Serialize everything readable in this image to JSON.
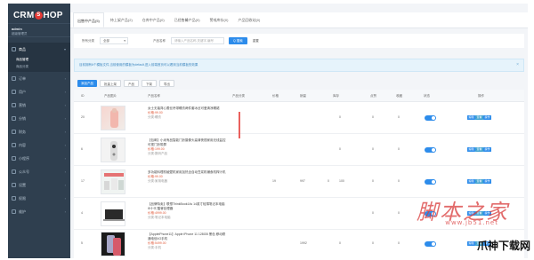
{
  "app": {
    "logo_prefix": "CRM",
    "logo_o": "S",
    "logo_suffix": "HOP"
  },
  "user": {
    "name": "admin",
    "role": "超级管理员"
  },
  "sidebar": {
    "items": [
      {
        "label": "商品",
        "active": true
      },
      {
        "label": "订单"
      },
      {
        "label": "用户"
      },
      {
        "label": "营销"
      },
      {
        "label": "分销"
      },
      {
        "label": "财务"
      },
      {
        "label": "内容"
      },
      {
        "label": "小程序"
      },
      {
        "label": "公众号"
      },
      {
        "label": "设置"
      },
      {
        "label": "权限"
      },
      {
        "label": "维护"
      }
    ],
    "submenu": [
      {
        "label": "商品管理",
        "active": true
      },
      {
        "label": "商品分类"
      }
    ]
  },
  "tabs": [
    {
      "label": "出售中产品(5)",
      "active": true
    },
    {
      "label": "待上架产品(2)"
    },
    {
      "label": "仓库中产品(0)"
    },
    {
      "label": "已经售馨产品(0)"
    },
    {
      "label": "警戒库存(0)"
    },
    {
      "label": "产品回收站(0)"
    }
  ],
  "filter": {
    "category_label": "所有分类",
    "category_value": "全部",
    "search_label": "产品名称",
    "search_placeholder": "请输入产品名称,关键字,编号",
    "search_button": "Q 搜索",
    "reset_button": "重置"
  },
  "notice": {
    "text": "目前拥有6个模板文件,当前使用的模板为default,进入前端首页可以看到当前模板的效果",
    "close": "×"
  },
  "actions": {
    "add_button": "添加产品",
    "batch_buttons": [
      "批量上架",
      "产品",
      "下架",
      "导出"
    ]
  },
  "table": {
    "columns": [
      "ID",
      "产品图片",
      "产品名称",
      "产品分类",
      "价格",
      "销量",
      "库存",
      "点赞",
      "收藏",
      "状态",
      "操作"
    ],
    "rows": [
      {
        "id": "20",
        "name": "女士无袖背心蕾丝吊带睡衣两件套冰丝可爱清凉睡裙",
        "tag": "价格:99.00",
        "meta": "分类:睡衣",
        "category": "",
        "price": "",
        "sales": "",
        "stock": "0",
        "likes": "0",
        "collect": "0",
        "ops": [
          "编辑",
          "查看",
          "操作"
        ]
      },
      {
        "id": "6",
        "name": "【包邮】小米有品智能门铃摄像头高清夜视家用无线监控可视门铃带屏",
        "tag": "价格:199.00",
        "meta": "分类:数码产品",
        "category": "",
        "price": "",
        "sales": "",
        "stock": "0",
        "likes": "0",
        "collect": "0",
        "ops": [
          "编辑",
          "查看",
          "操作"
        ]
      },
      {
        "id": "17",
        "name": "多功能料理机破壁机家用加热全自动豆浆机辅食机榨汁机",
        "tag": "价格:99.00",
        "meta": "分类:家用电器",
        "category": "19",
        "price": "997",
        "sales": "0",
        "stock": "100",
        "likes": "0",
        "collect": "0",
        "ops": [
          "编辑",
          "查看",
          "操作"
        ]
      },
      {
        "id": "4",
        "name": "【品牌特卖】联想ThinkBook14s 14英寸轻薄笔记本电脑 i5十代 酷睿处理器",
        "tag": "价格:4999.00",
        "meta": "分类:笔记本电脑",
        "category": "",
        "price": "",
        "sales": "",
        "stock": "",
        "likes": "0",
        "collect": "0",
        "ops": [
          "编辑",
          "查看",
          "操作"
        ]
      },
      {
        "id": "5",
        "name": "【AppleiPhone11】Apple iPhone 11 128GB 黑色 移动联通电信4G手机",
        "tag": "价格:5499.00",
        "meta": "分类:手机",
        "category": "",
        "price": "1992",
        "sales": "",
        "stock": "0",
        "likes": "0",
        "collect": "0",
        "ops": [
          "编辑",
          "查看",
          "操作"
        ]
      }
    ]
  },
  "watermark": {
    "text": "脚本之家",
    "url": "www.jb51.net",
    "corner": "爪神下载网"
  }
}
